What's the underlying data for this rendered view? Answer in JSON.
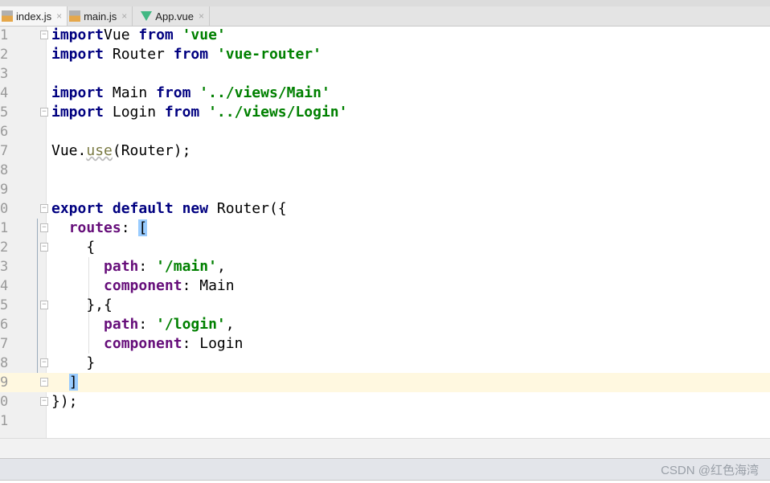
{
  "tabs": [
    {
      "label": "index.js",
      "icon": "js-file-icon",
      "active": true
    },
    {
      "label": "main.js",
      "icon": "js-file-icon",
      "active": false
    },
    {
      "label": "App.vue",
      "icon": "vue-file-icon",
      "active": false
    }
  ],
  "tab_close": "×",
  "current_line": 19,
  "lines": [
    {
      "n": "1",
      "fold": true,
      "tokens": [
        [
          "kw",
          "import"
        ],
        [
          "",
          "Vue "
        ],
        [
          "kw",
          "from"
        ],
        [
          "",
          " "
        ],
        [
          "str",
          "'vue'"
        ]
      ]
    },
    {
      "n": "2",
      "tokens": [
        [
          "kw",
          "import"
        ],
        [
          "",
          " Router "
        ],
        [
          "kw",
          "from"
        ],
        [
          "",
          " "
        ],
        [
          "str",
          "'vue-router'"
        ]
      ]
    },
    {
      "n": "3",
      "tokens": []
    },
    {
      "n": "4",
      "tokens": [
        [
          "kw",
          "import"
        ],
        [
          "",
          " Main "
        ],
        [
          "kw",
          "from"
        ],
        [
          "",
          " "
        ],
        [
          "str",
          "'../views/Main'"
        ]
      ]
    },
    {
      "n": "5",
      "fold": true,
      "tokens": [
        [
          "kw",
          "import"
        ],
        [
          "",
          " Login "
        ],
        [
          "kw",
          "from"
        ],
        [
          "",
          " "
        ],
        [
          "str",
          "'../views/Login'"
        ]
      ]
    },
    {
      "n": "6",
      "tokens": []
    },
    {
      "n": "7",
      "tokens": [
        [
          "",
          "Vue."
        ],
        [
          "fn",
          "use"
        ],
        [
          "",
          "(Router);"
        ]
      ]
    },
    {
      "n": "8",
      "tokens": []
    },
    {
      "n": "9",
      "tokens": []
    },
    {
      "n": "0",
      "fold": true,
      "tokens": [
        [
          "kw",
          "export"
        ],
        [
          "",
          " "
        ],
        [
          "kw",
          "default"
        ],
        [
          "",
          " "
        ],
        [
          "kw",
          "new"
        ],
        [
          "",
          " Router({"
        ]
      ]
    },
    {
      "n": "1",
      "fold": true,
      "tokens": [
        [
          "",
          "  "
        ],
        [
          "prop",
          "routes"
        ],
        [
          "",
          ": "
        ],
        [
          "br",
          "["
        ]
      ]
    },
    {
      "n": "2",
      "fold": true,
      "tokens": [
        [
          "",
          "    {"
        ]
      ]
    },
    {
      "n": "3",
      "tokens": [
        [
          "",
          "      "
        ],
        [
          "prop",
          "path"
        ],
        [
          "",
          ": "
        ],
        [
          "str",
          "'/main'"
        ],
        [
          "",
          ","
        ]
      ]
    },
    {
      "n": "4",
      "tokens": [
        [
          "",
          "      "
        ],
        [
          "prop",
          "component"
        ],
        [
          "",
          ": Main"
        ]
      ]
    },
    {
      "n": "5",
      "fold": true,
      "tokens": [
        [
          "",
          "    },{"
        ]
      ]
    },
    {
      "n": "6",
      "tokens": [
        [
          "",
          "      "
        ],
        [
          "prop",
          "path"
        ],
        [
          "",
          ": "
        ],
        [
          "str",
          "'/login'"
        ],
        [
          "",
          ","
        ]
      ]
    },
    {
      "n": "7",
      "tokens": [
        [
          "",
          "      "
        ],
        [
          "prop",
          "component"
        ],
        [
          "",
          ": Login"
        ]
      ]
    },
    {
      "n": "8",
      "fold": true,
      "tokens": [
        [
          "",
          "    }"
        ]
      ]
    },
    {
      "n": "9",
      "fold": true,
      "tokens": [
        [
          "",
          "  "
        ],
        [
          "br",
          "]"
        ]
      ]
    },
    {
      "n": "0",
      "fold": true,
      "tokens": [
        [
          "",
          "});"
        ]
      ]
    },
    {
      "n": "1",
      "tokens": []
    }
  ],
  "watermark": "CSDN @红色海湾"
}
